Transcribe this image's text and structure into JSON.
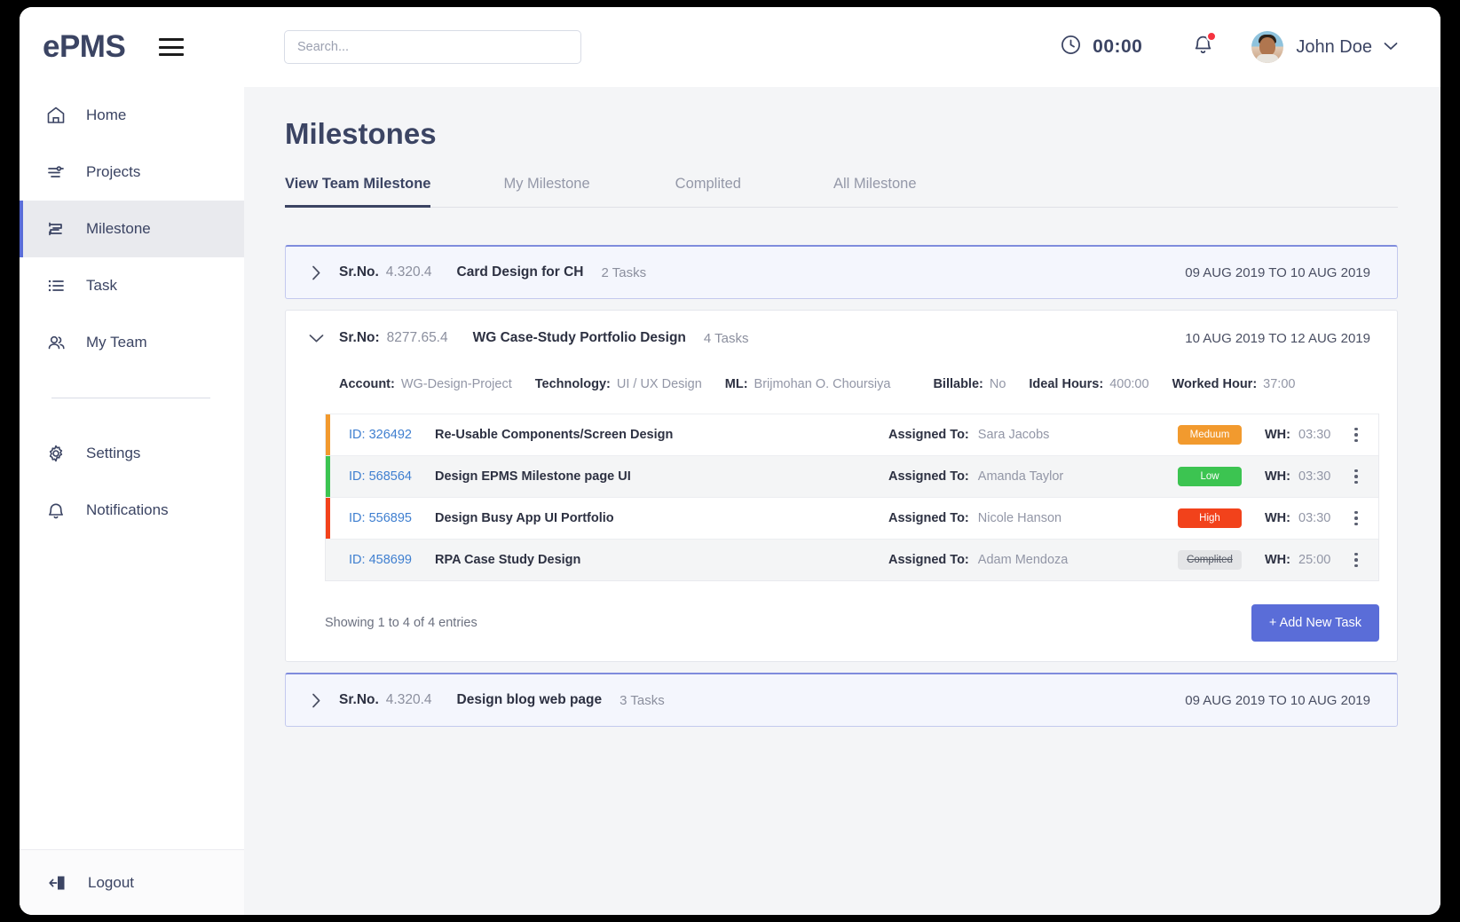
{
  "app": {
    "brand": "ePMS"
  },
  "topbar": {
    "search_placeholder": "Search...",
    "search_value": "",
    "timer": "00:00",
    "username": "John Doe"
  },
  "sidebar": {
    "items": [
      {
        "label": "Home",
        "icon": "home-icon"
      },
      {
        "label": "Projects",
        "icon": "projects-icon"
      },
      {
        "label": "Milestone",
        "icon": "milestone-icon"
      },
      {
        "label": "Task",
        "icon": "task-list-icon"
      },
      {
        "label": "My Team",
        "icon": "team-icon"
      },
      {
        "label": "Settings",
        "icon": "gear-icon"
      },
      {
        "label": "Notifications",
        "icon": "bell-icon"
      }
    ],
    "logout": {
      "label": "Logout",
      "icon": "logout-icon"
    }
  },
  "main": {
    "title": "Milestones",
    "tabs": [
      {
        "label": "View Team Milestone",
        "active": true
      },
      {
        "label": "My Milestone",
        "active": false
      },
      {
        "label": "Complited",
        "active": false
      },
      {
        "label": "All Milestone",
        "active": false
      }
    ],
    "milestones": [
      {
        "srno_label": "Sr.No.",
        "srno": "4.320.4",
        "name": "Card Design for CH",
        "tasks": "2 Tasks",
        "dates": "09 AUG 2019 TO 10 AUG 2019",
        "expanded": false
      },
      {
        "srno_label": "Sr.No:",
        "srno": "8277.65.4",
        "name": "WG Case-Study Portfolio Design",
        "tasks": "4 Tasks",
        "dates": "10 AUG 2019 TO 12 AUG 2019",
        "expanded": true,
        "meta": {
          "account_label": "Account:",
          "account_value": "WG-Design-Project",
          "technology_label": "Technology:",
          "technology_value": "UI / UX Design",
          "ml_label": "ML:",
          "ml_value": "Brijmohan O. Choursiya",
          "billable_label": "Billable:",
          "billable_value": "No",
          "ideal_hours_label": "Ideal Hours:",
          "ideal_hours_value": "400:00",
          "worked_hour_label": "Worked Hour:",
          "worked_hour_value": "37:00"
        },
        "task_columns": {
          "id_prefix": "ID:",
          "assigned_label": "Assigned To:",
          "wh_label": "WH:"
        },
        "tasks_list": [
          {
            "id": "326492",
            "title": "Re-Usable Components/Screen Design",
            "assignee": "Sara Jacobs",
            "priority": "Meduum",
            "priority_color": "#f29a2e",
            "wh": "03:30"
          },
          {
            "id": "568564",
            "title": "Design EPMS Milestone page UI",
            "assignee": "Amanda Taylor",
            "priority": "Low",
            "priority_color": "#3cc451",
            "wh": "03:30"
          },
          {
            "id": "556895",
            "title": "Design Busy App UI Portfolio",
            "assignee": "Nicole Hanson",
            "priority": "High",
            "priority_color": "#f2421b",
            "wh": "03:30"
          },
          {
            "id": "458699",
            "title": "RPA Case Study Design",
            "assignee": "Adam Mendoza",
            "priority": "Complited",
            "priority_color": "#e4e5e7",
            "wh": "25:00"
          }
        ],
        "showing": "Showing 1 to 4 of 4 entries",
        "add_button": "+ Add New Task"
      },
      {
        "srno_label": "Sr.No.",
        "srno": "4.320.4",
        "name": "Design blog web page",
        "tasks": "3 Tasks",
        "dates": "09 AUG 2019 TO 10 AUG 2019",
        "expanded": false
      }
    ]
  },
  "colors": {
    "accent": "#5a6dd8",
    "text": "#3b4463",
    "muted": "#9296a6"
  }
}
